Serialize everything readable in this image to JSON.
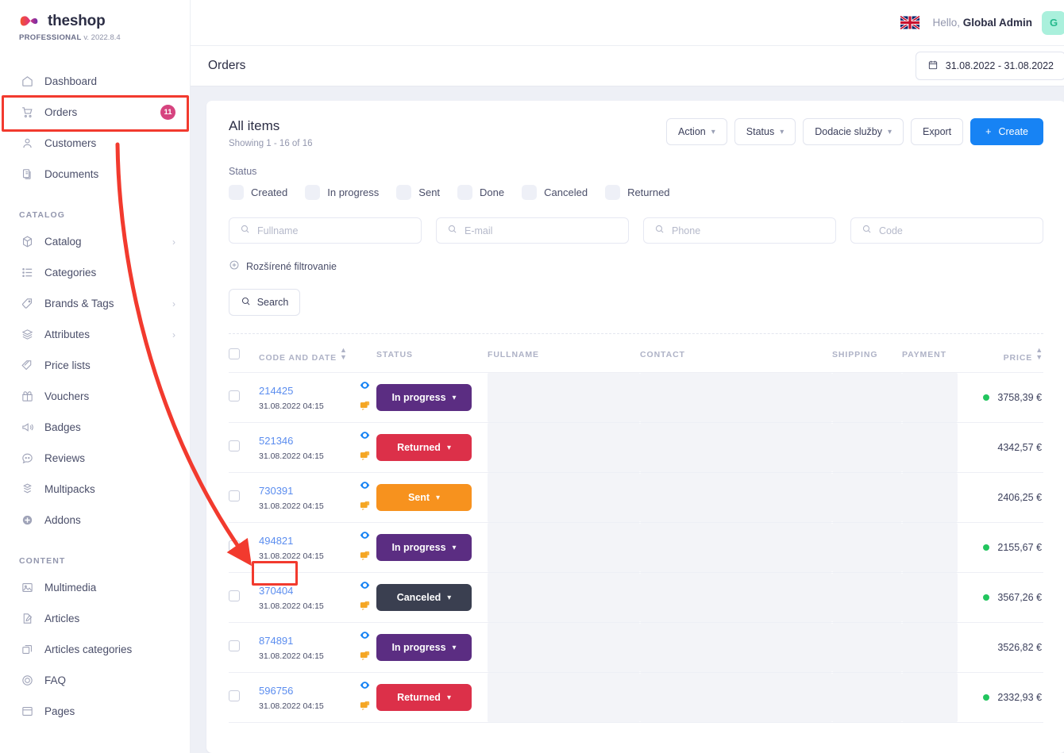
{
  "brand": {
    "name": "theshop",
    "edition": "PROFESSIONAL",
    "version": "v. 2022.8.4",
    "logo_icon": "infinity-logo-icon"
  },
  "sidebar": {
    "items": [
      {
        "label": "Dashboard",
        "icon": "home-icon",
        "badge": null,
        "chevron": false
      },
      {
        "label": "Orders",
        "icon": "cart-icon",
        "badge": "11",
        "chevron": false
      },
      {
        "label": "Customers",
        "icon": "user-icon",
        "badge": null,
        "chevron": false
      },
      {
        "label": "Documents",
        "icon": "documents-icon",
        "badge": null,
        "chevron": false
      }
    ],
    "groups": [
      {
        "title": "CATALOG",
        "items": [
          {
            "label": "Catalog",
            "icon": "box-icon",
            "chevron": true
          },
          {
            "label": "Categories",
            "icon": "list-icon",
            "chevron": false
          },
          {
            "label": "Brands & Tags",
            "icon": "tag-icon",
            "chevron": true
          },
          {
            "label": "Attributes",
            "icon": "layers-icon",
            "chevron": true
          },
          {
            "label": "Price lists",
            "icon": "pricetag-icon",
            "chevron": false
          },
          {
            "label": "Vouchers",
            "icon": "gift-icon",
            "chevron": false
          },
          {
            "label": "Badges",
            "icon": "megaphone-icon",
            "chevron": false
          },
          {
            "label": "Reviews",
            "icon": "comment-icon",
            "chevron": false
          },
          {
            "label": "Multipacks",
            "icon": "stack-icon",
            "chevron": false
          },
          {
            "label": "Addons",
            "icon": "plus-circle-icon",
            "chevron": false
          }
        ]
      },
      {
        "title": "CONTENT",
        "items": [
          {
            "label": "Multimedia",
            "icon": "image-icon",
            "chevron": false
          },
          {
            "label": "Articles",
            "icon": "pencil-doc-icon",
            "chevron": false
          },
          {
            "label": "Articles categories",
            "icon": "copy-icon",
            "chevron": false
          },
          {
            "label": "FAQ",
            "icon": "question-circle-icon",
            "chevron": false
          },
          {
            "label": "Pages",
            "icon": "page-icon",
            "chevron": false
          }
        ]
      }
    ]
  },
  "topbar": {
    "flag_icon": "uk-flag-icon",
    "greeting": "Hello,",
    "user_name": "Global Admin",
    "avatar_initial": "G"
  },
  "pagebar": {
    "title": "Orders",
    "calendar_icon": "calendar-icon",
    "date_range": "31.08.2022 - 31.08.2022"
  },
  "card": {
    "heading": "All items",
    "showing": "Showing 1 - 16 of 16",
    "buttons": [
      {
        "label": "Action",
        "caret": true
      },
      {
        "label": "Status",
        "caret": true
      },
      {
        "label": "Dodacie služby",
        "caret": true
      },
      {
        "label": "Export",
        "caret": false
      }
    ],
    "create_label": "Create",
    "create_icon": "plus-icon",
    "create_color": "#1783f4"
  },
  "filters": {
    "status_label": "Status",
    "status_options": [
      "Created",
      "In progress",
      "Sent",
      "Done",
      "Canceled",
      "Returned"
    ],
    "inputs": [
      {
        "placeholder": "Fullname",
        "value": "",
        "icon": "search-icon"
      },
      {
        "placeholder": "E-mail",
        "value": "",
        "icon": "search-icon"
      },
      {
        "placeholder": "Phone",
        "value": "",
        "icon": "search-icon"
      },
      {
        "placeholder": "Code",
        "value": "",
        "icon": "search-icon"
      }
    ],
    "advanced_label": "Rozšírené filtrovanie",
    "advanced_icon": "plus-circle-icon",
    "search_label": "Search",
    "search_icon": "search-icon"
  },
  "table": {
    "columns": [
      {
        "label": "CODE AND DATE",
        "sortable": true
      },
      {
        "label": "STATUS",
        "sortable": false
      },
      {
        "label": "FULLNAME",
        "sortable": false
      },
      {
        "label": "CONTACT",
        "sortable": false
      },
      {
        "label": "SHIPPING",
        "sortable": false
      },
      {
        "label": "PAYMENT",
        "sortable": false
      },
      {
        "label": "PRICE",
        "sortable": true
      }
    ],
    "rows": [
      {
        "code": "214425",
        "date": "31.08.2022 04:15",
        "status": "In progress",
        "status_color": "#5b2d82",
        "dot": true,
        "price": "3758,39 €"
      },
      {
        "code": "521346",
        "date": "31.08.2022 04:15",
        "status": "Returned",
        "status_color": "#dc3049",
        "dot": false,
        "price": "4342,57 €"
      },
      {
        "code": "730391",
        "date": "31.08.2022 04:15",
        "status": "Sent",
        "status_color": "#f7921e",
        "dot": false,
        "price": "2406,25 €"
      },
      {
        "code": "494821",
        "date": "31.08.2022 04:15",
        "status": "In progress",
        "status_color": "#5b2d82",
        "dot": true,
        "price": "2155,67 €"
      },
      {
        "code": "370404",
        "date": "31.08.2022 04:15",
        "status": "Canceled",
        "status_color": "#3a3f50",
        "dot": true,
        "price": "3567,26 €"
      },
      {
        "code": "874891",
        "date": "31.08.2022 04:15",
        "status": "In progress",
        "status_color": "#5b2d82",
        "dot": false,
        "price": "3526,82 €"
      },
      {
        "code": "596756",
        "date": "31.08.2022 04:15",
        "status": "Returned",
        "status_color": "#dc3049",
        "dot": true,
        "price": "2332,93 €"
      }
    ]
  },
  "annotations": {
    "highlight_color": "#f23a2e",
    "highlighted_nav_item": "Orders",
    "highlighted_cell_code": "494821",
    "arrow": "curved-arrow-from-orders-nav-to-order-494821"
  }
}
